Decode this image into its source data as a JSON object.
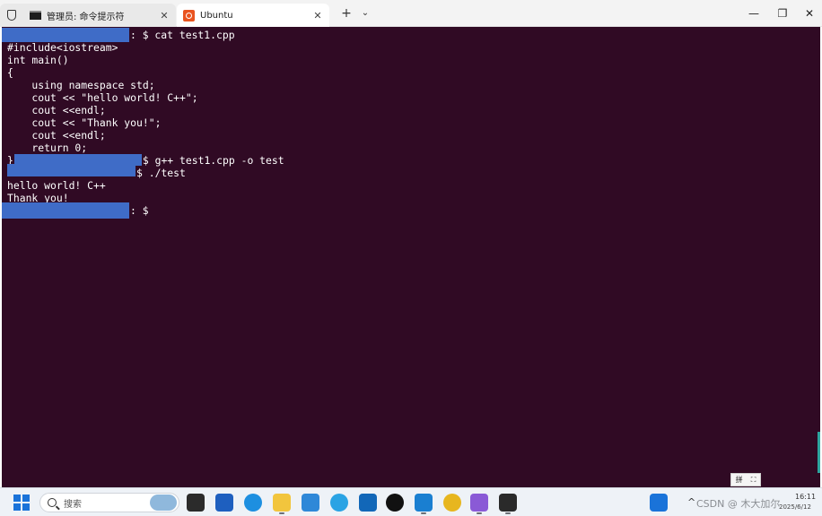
{
  "titlebar": {
    "tabs": [
      {
        "label": "管理员: 命令提示符",
        "icon": "cmd-icon",
        "close": "✕"
      },
      {
        "label": "Ubuntu",
        "icon": "ubuntu-icon",
        "close": "✕"
      }
    ],
    "new_tab": "+",
    "dropdown": "⌄",
    "window_controls": {
      "minimize": "—",
      "maximize": "❐",
      "close": "✕"
    }
  },
  "terminal": {
    "lines": [
      ": $ cat test1.cpp",
      "#include<iostream>",
      "int main()",
      "{",
      "    using namespace std;",
      "    cout << \"hello world! C++\";",
      "    cout <<endl;",
      "    cout << \"Thank you!\";",
      "    cout <<endl;",
      "    return 0;",
      "}                     $ g++ test1.cpp -o test",
      "                     $ ./test",
      "hello world! C++",
      "Thank you!",
      ": $"
    ],
    "colors": {
      "background": "#300a24",
      "text": "#ffffff",
      "redaction": "#3f6cc7"
    }
  },
  "ime_widget": {
    "label": "拼"
  },
  "taskbar": {
    "search_placeholder": "搜索",
    "tray": {
      "chevron": "^",
      "watermark": "CSDN @ 木大加尔",
      "time": "16:11",
      "date": "2025/6/12"
    }
  }
}
